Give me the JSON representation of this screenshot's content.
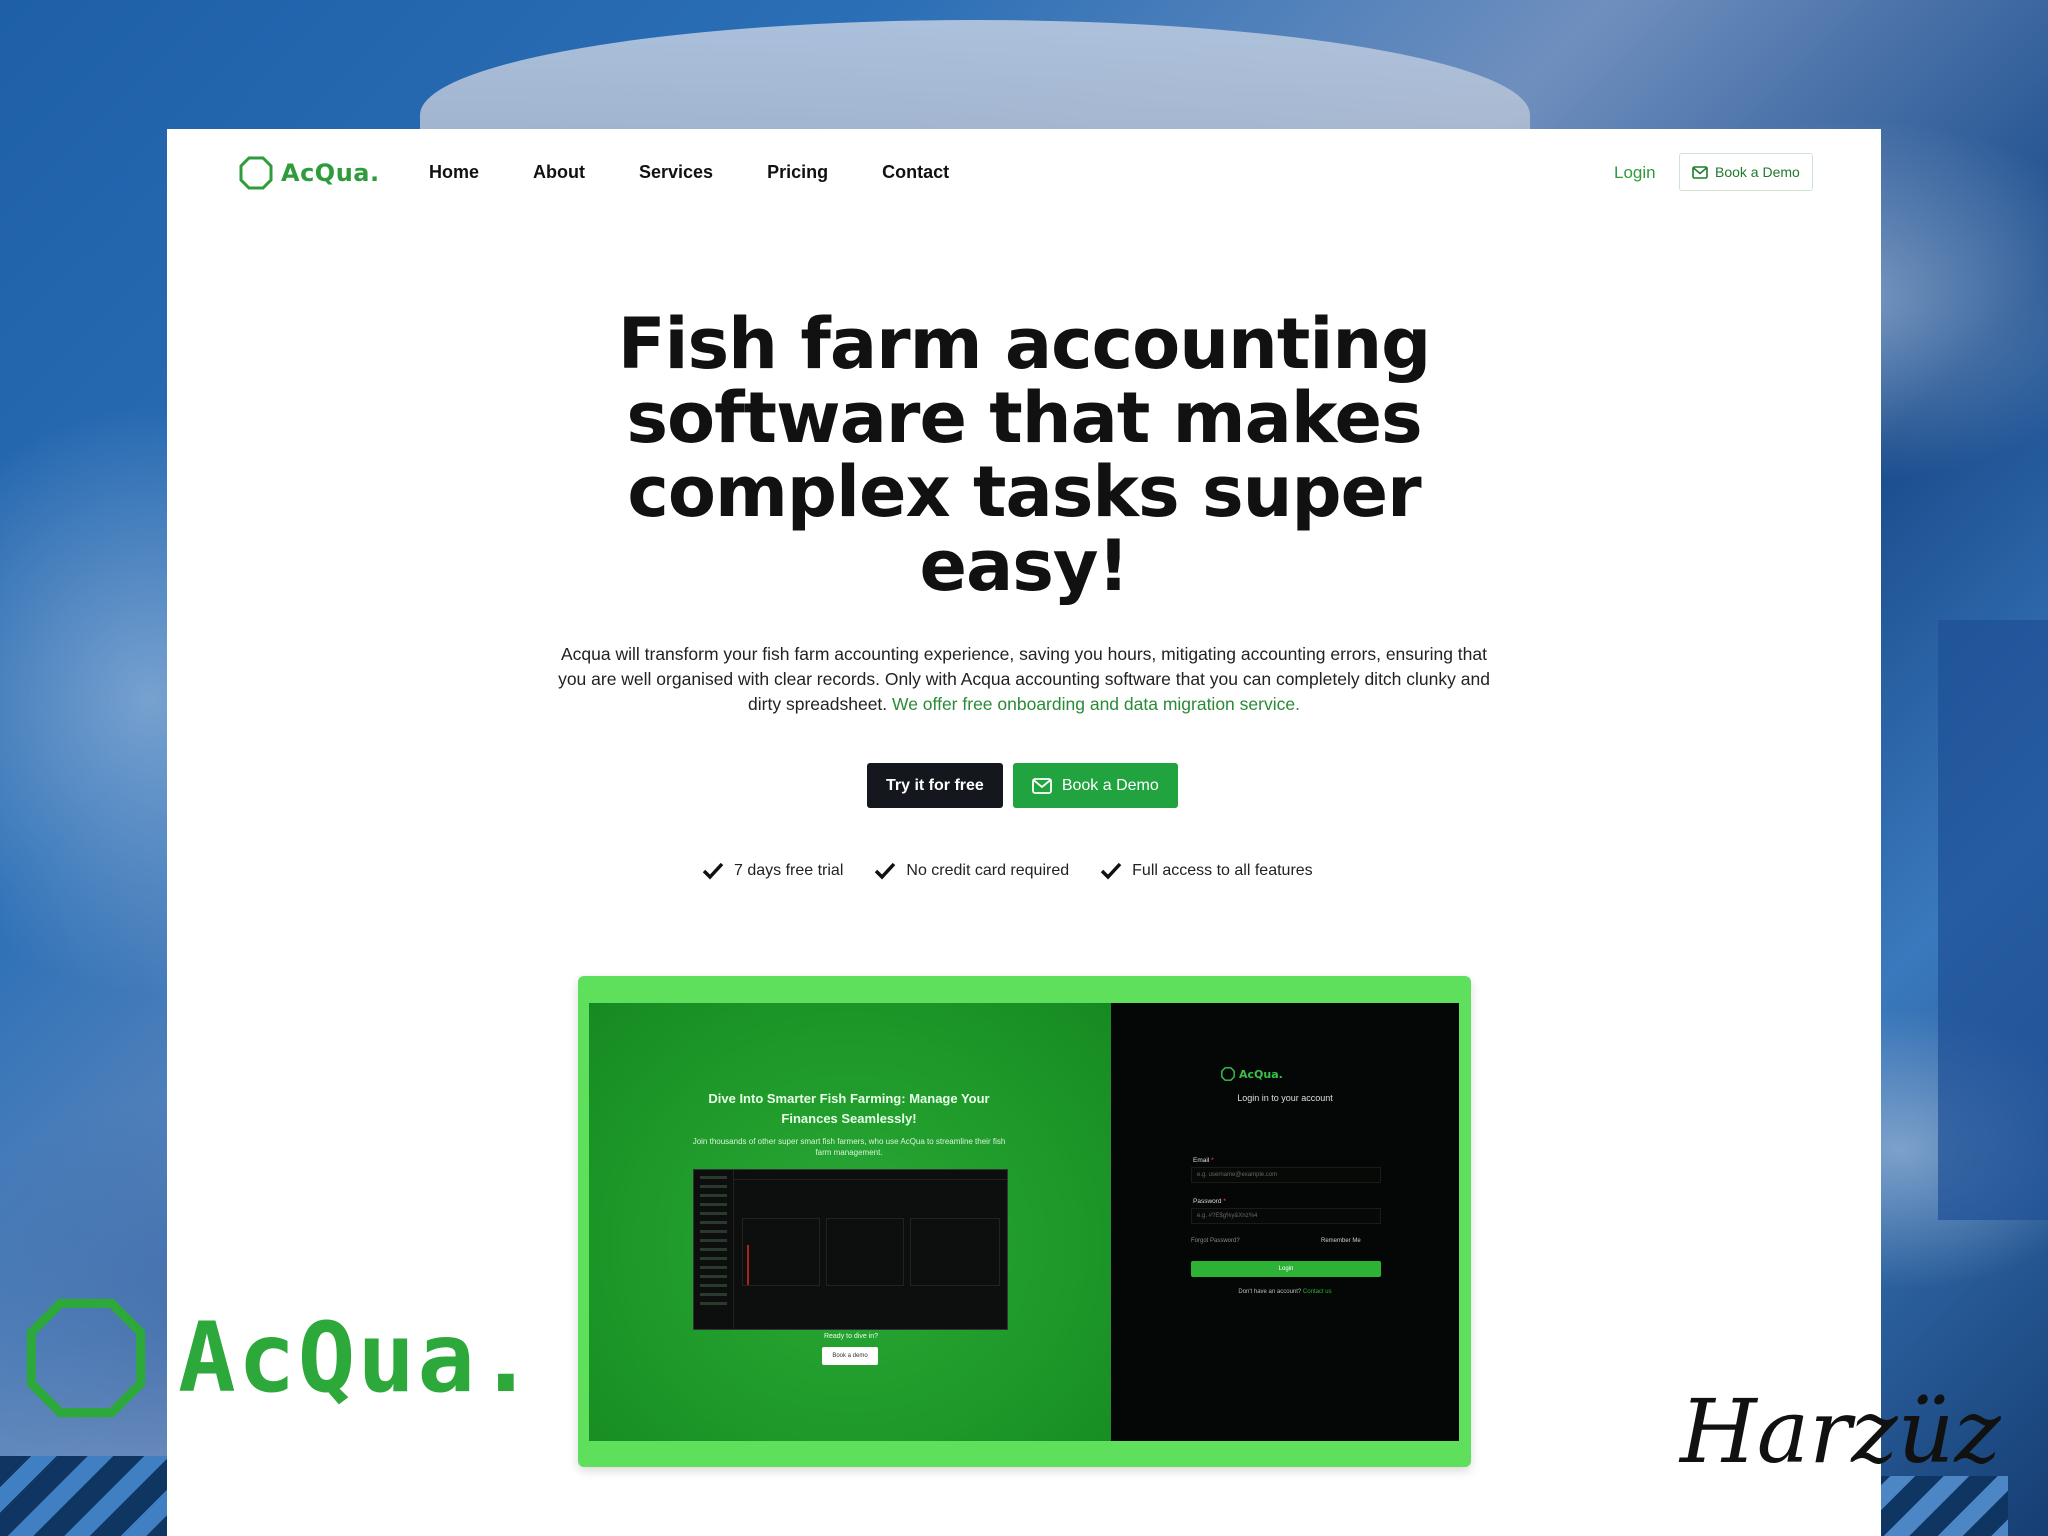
{
  "brand": {
    "name": "AcQua.",
    "color": "#2e9c3a"
  },
  "nav": {
    "items": [
      "Home",
      "About",
      "Services",
      "Pricing",
      "Contact"
    ],
    "login": "Login",
    "demo": "Book a Demo"
  },
  "hero": {
    "headline": "Fish farm accounting software that makes complex tasks super easy!",
    "sub_main": "Acqua will transform your fish farm accounting experience, saving you hours, mitigating accounting errors, ensuring that you are well organised with clear records. Only with Acqua accounting software that you can completely ditch clunky and dirty spreadsheet. ",
    "sub_highlight": "We offer free onboarding and data migration service.",
    "cta_primary": "Try it for free",
    "cta_secondary": "Book a Demo",
    "checks": [
      "7 days free trial",
      "No credit card required",
      "Full access to all features"
    ]
  },
  "preview": {
    "left_title": "Dive Into Smarter Fish Farming: Manage Your Finances Seamlessly!",
    "left_sub": "Join thousands of other super smart fish farmers, who use AcQua to streamline their fish farm management.",
    "cta_text": "Ready to dive in?",
    "cta_button": "Book a demo",
    "right_brand": "AcQua.",
    "right_heading": "Login in to your account",
    "email_label": "Email",
    "email_placeholder": "e.g. username@example.com",
    "password_label": "Password",
    "password_placeholder": "e.g. #?E$g%y&Xnz%4",
    "forgot": "Forgot Password?",
    "remember": "Remember Me",
    "login_button": "Login",
    "no_account": "Don't have an account? ",
    "contact": "Contact us"
  },
  "overlay": {
    "logo_text": "AcQua.",
    "signature": "Harzüz"
  },
  "colors": {
    "accent": "#21a340",
    "dark_button": "#15171f",
    "preview_frame": "#5ee05c"
  }
}
